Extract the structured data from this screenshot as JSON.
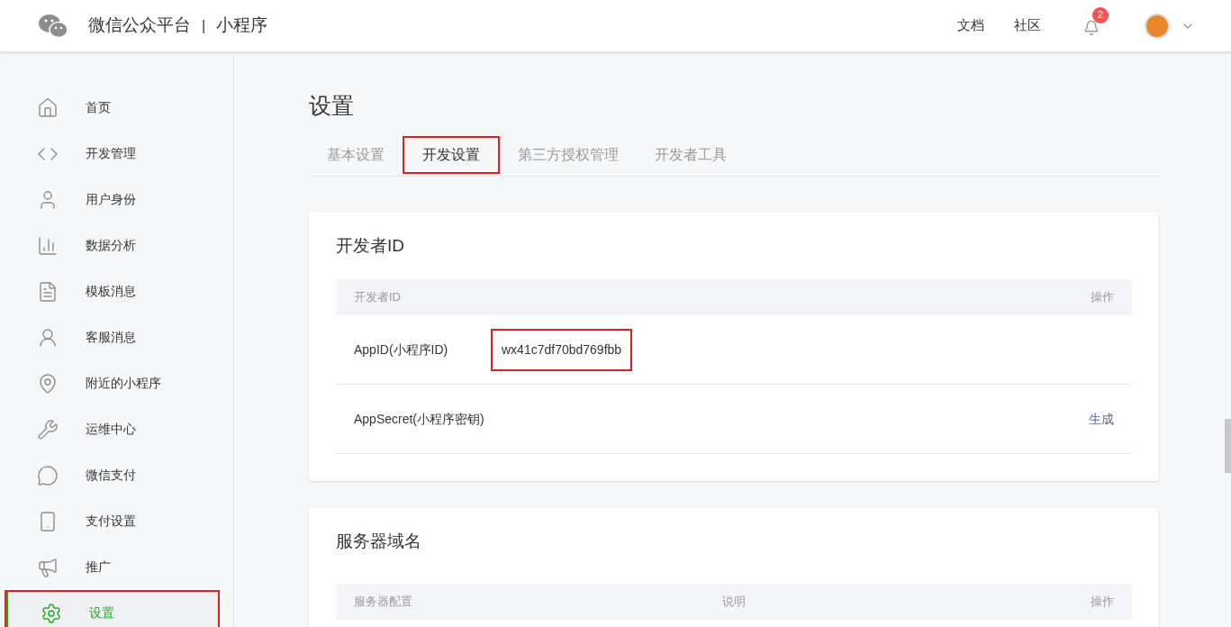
{
  "header": {
    "brand": "微信公众平台",
    "divider": "|",
    "product": "小程序",
    "links": [
      "文档",
      "社区"
    ],
    "notification_count": "2"
  },
  "sidebar": {
    "items": [
      {
        "label": "首页",
        "selected": false,
        "annotated": false
      },
      {
        "label": "开发管理",
        "selected": false,
        "annotated": false
      },
      {
        "label": "用户身份",
        "selected": false,
        "annotated": false
      },
      {
        "label": "数据分析",
        "selected": false,
        "annotated": false
      },
      {
        "label": "模板消息",
        "selected": false,
        "annotated": false
      },
      {
        "label": "客服消息",
        "selected": false,
        "annotated": false
      },
      {
        "label": "附近的小程序",
        "selected": false,
        "annotated": false
      },
      {
        "label": "运维中心",
        "selected": false,
        "annotated": false
      },
      {
        "label": "微信支付",
        "selected": false,
        "annotated": false
      },
      {
        "label": "支付设置",
        "selected": false,
        "annotated": false
      },
      {
        "label": "推广",
        "selected": false,
        "annotated": false
      },
      {
        "label": "设置",
        "selected": true,
        "annotated": true
      }
    ]
  },
  "page_title": "设置",
  "tabs": [
    {
      "label": "基本设置",
      "selected": false,
      "annotated": false
    },
    {
      "label": "开发设置",
      "selected": true,
      "annotated": true
    },
    {
      "label": "第三方授权管理",
      "selected": false,
      "annotated": false
    },
    {
      "label": "开发者工具",
      "selected": false,
      "annotated": false
    }
  ],
  "developer_id_card": {
    "title": "开发者ID",
    "columns": [
      "开发者ID",
      "操作"
    ],
    "rows": [
      {
        "name": "AppID(小程序ID)",
        "value": "wx41c7df70bd769fbb",
        "value_annotated": true
      },
      {
        "name": "AppSecret(小程序密钥)",
        "action": "生成"
      }
    ]
  },
  "server_domain_card": {
    "title": "服务器域名",
    "columns": [
      "服务器配置",
      "说明",
      "操作"
    ]
  }
}
